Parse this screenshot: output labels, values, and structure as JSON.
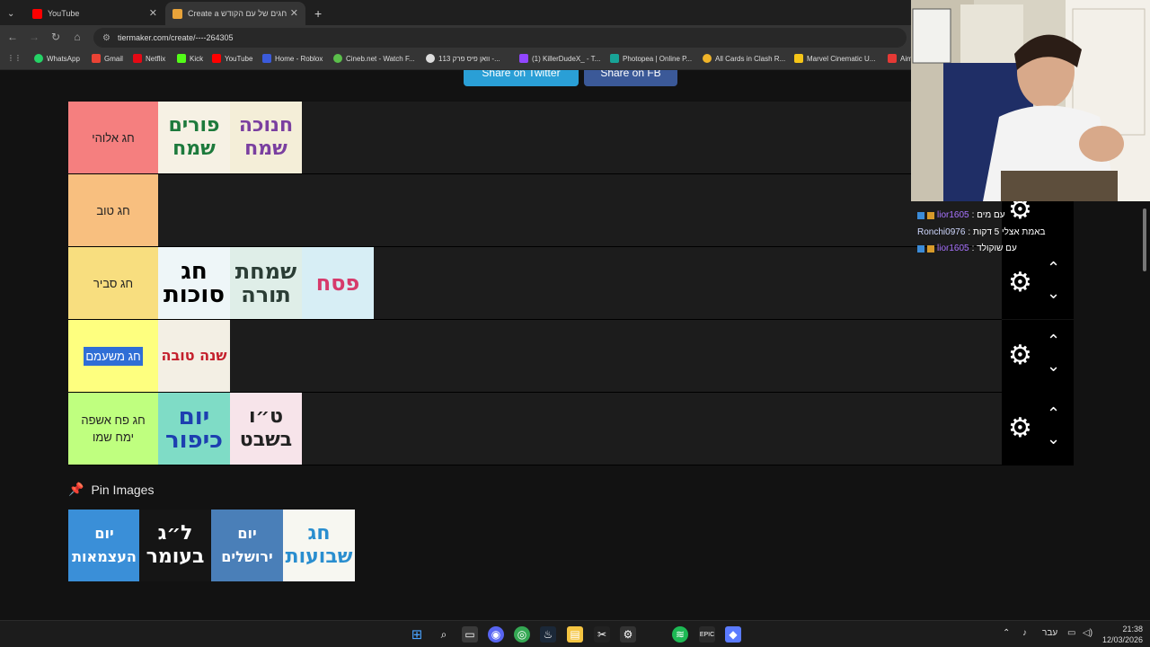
{
  "tabs": [
    {
      "title": "YouTube"
    },
    {
      "title": "Create a חגים של עם הקודש Tier"
    }
  ],
  "address": {
    "url": "tiermaker.com/create/----264305"
  },
  "bookmarks": [
    "WhatsApp",
    "Gmail",
    "Netflix",
    "Kick",
    "YouTube",
    "Home - Roblox",
    "Cineb.net - Watch F...",
    "וואן פיס פרק 113 -...",
    "(1) KillerDudeX_ - T...",
    "Photopea | Online P...",
    "All Cards in Clash R...",
    "Marvel Cinematic U...",
    "Aim"
  ],
  "share": {
    "twitter": "Share on Twitter",
    "fb": "Share on FB"
  },
  "tiers": [
    {
      "label": "חג אלוהי",
      "color": "#f57f7f",
      "items": [
        "פורים שמח",
        "חנוכה שמח"
      ]
    },
    {
      "label": "חג טוב",
      "color": "#f8bf7f",
      "items": []
    },
    {
      "label": "חג סביר",
      "color": "#f8de7f",
      "items": [
        "חג סוכות",
        "שמחת תורה",
        "פסח"
      ]
    },
    {
      "label": "חג משעמם",
      "color": "#feff7f",
      "items": [
        "שנה טובה"
      ]
    },
    {
      "label": "חג פח אשפה ימח שמו",
      "color": "#bfff7f",
      "items": [
        "יום כיפור",
        "ט״ו בשבט"
      ]
    }
  ],
  "pin": {
    "title": "Pin Images",
    "items": [
      "יום העצמאות",
      "ל״ג בעומר",
      "יום ירושלים",
      "חג שבועות"
    ]
  },
  "chat": [
    {
      "user": "lior1605",
      "msg": ": עם מים"
    },
    {
      "user": "Ronchi0976",
      "msg": ": באמת אצלי 5 דקות"
    },
    {
      "user": "lior1605",
      "msg": ": עם שוקולד"
    }
  ],
  "taskbar": {
    "lang": "עבר",
    "time": "21:38",
    "date": "12/03/2026"
  },
  "icons": {
    "gear": "gear-icon",
    "up": "chevron-up-icon",
    "down": "chevron-down-icon",
    "pin": "pin-icon"
  }
}
